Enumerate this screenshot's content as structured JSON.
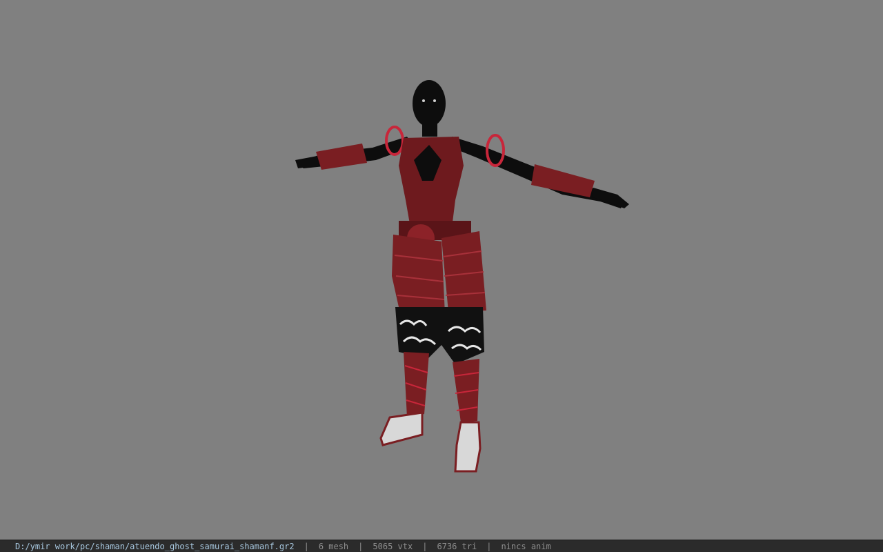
{
  "viewport": {
    "background": "#808080",
    "model": {
      "skin_color": "#0d0d0d",
      "armor_color": "#7a1e22",
      "armor_highlight": "#a8313a",
      "rope_color": "#c8263a",
      "pattern_color": "#e6e6e6"
    }
  },
  "statusbar": {
    "file_path": "D:/ymir work/pc/shaman/atuendo_ghost_samurai_shamanf.gr2",
    "separator": "|",
    "mesh_count": "6 mesh",
    "vertex_count": "5065 vtx",
    "triangle_count": "6736 tri",
    "animation": "nincs anim"
  }
}
